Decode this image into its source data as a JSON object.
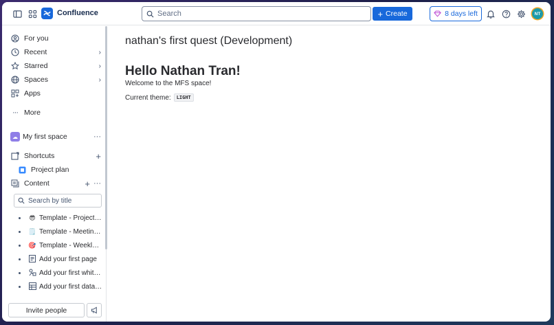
{
  "topbar": {
    "app_name": "Confluence",
    "search_placeholder": "Search",
    "create_label": "Create",
    "trial_label": "8 days left",
    "avatar_initials": "NT",
    "accent_color": "#1868db"
  },
  "sidebar": {
    "nav": [
      {
        "label": "For you",
        "icon": "person-circle-icon"
      },
      {
        "label": "Recent",
        "icon": "clock-icon"
      },
      {
        "label": "Starred",
        "icon": "star-icon"
      },
      {
        "label": "Spaces",
        "icon": "globe-icon"
      },
      {
        "label": "Apps",
        "icon": "apps-icon"
      },
      {
        "label": "More",
        "icon": "more-icon"
      }
    ],
    "space_name": "My first space",
    "shortcuts_label": "Shortcuts",
    "project_plan_label": "Project plan",
    "content_label": "Content",
    "search_title_placeholder": "Search by title",
    "tree": [
      {
        "label": "Template - Project plan",
        "emoji": "😎"
      },
      {
        "label": "Template - Meeting notes",
        "emoji": "🗒️"
      },
      {
        "label": "Template - Weekly status report",
        "emoji": "🎯"
      },
      {
        "label": "Add your first page",
        "emoji": "page-icon"
      },
      {
        "label": "Add your first whiteboard",
        "emoji": "whiteboard-icon"
      },
      {
        "label": "Add your first database",
        "emoji": "database-icon"
      }
    ],
    "invite_label": "Invite people"
  },
  "main": {
    "page_title": "nathan's first quest (Development)",
    "heading": "Hello Nathan Tran!",
    "welcome": "Welcome to the MFS space!",
    "theme_label": "Current theme:",
    "theme_value": "LIGHT"
  }
}
